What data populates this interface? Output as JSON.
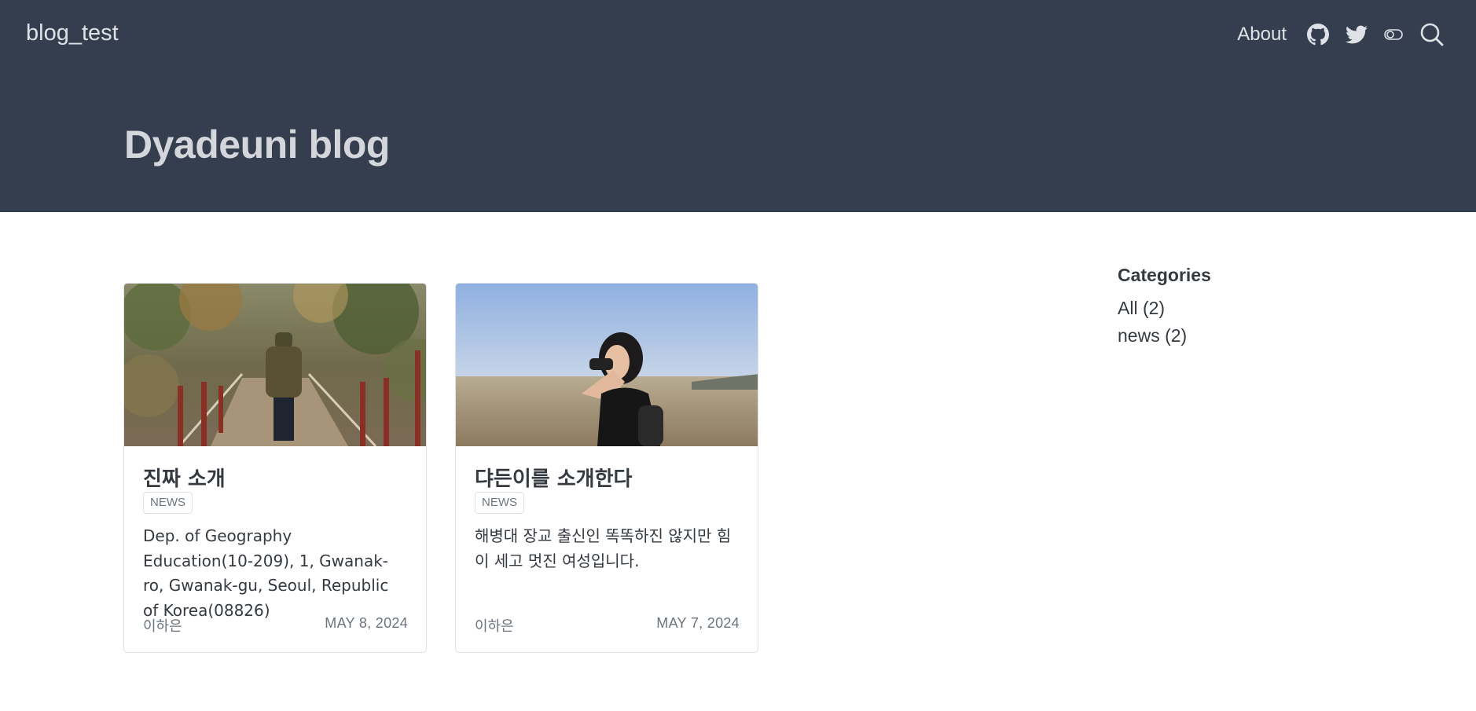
{
  "navbar": {
    "brand": "blog_test",
    "about_label": "About",
    "icons": [
      "github-icon",
      "twitter-icon",
      "toggle-icon",
      "search-icon"
    ]
  },
  "banner": {
    "title": "Dyadeuni blog"
  },
  "posts": [
    {
      "title": "진짜 소개",
      "category": "NEWS",
      "description": "Dep. of Geography Education(10-209), 1, Gwanak-ro, Gwanak-gu, Seoul, Republic of Korea(08826)",
      "author": "이하은",
      "date": "MAY 8, 2024"
    },
    {
      "title": "댜든이를 소개한다",
      "category": "NEWS",
      "description": "해병대 장교 출신인 똑똑하진 않지만 힘이 세고 멋진 여성입니다.",
      "author": "이하은",
      "date": "MAY 7, 2024"
    }
  ],
  "sidebar": {
    "heading": "Categories",
    "items": [
      {
        "label": "All (2)"
      },
      {
        "label": "news (2)"
      }
    ]
  },
  "colors": {
    "banner": "#343e4f",
    "banner_text": "#dee2e6",
    "body_text": "#343a40",
    "muted": "#6c757d",
    "border": "#dee2e6"
  }
}
